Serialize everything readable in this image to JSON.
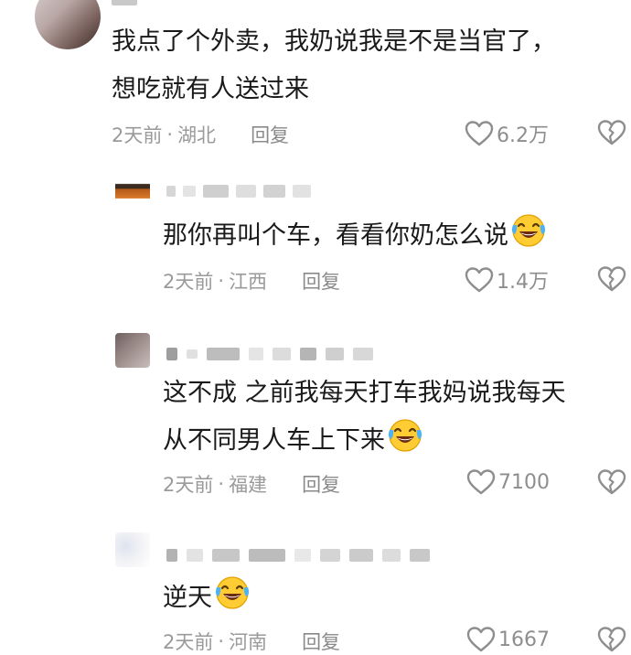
{
  "comments": [
    {
      "text_lines": [
        "我点了个外卖，我奶说我是不是当官了，",
        "想吃就有人送过来"
      ],
      "time": "2天前",
      "location": "湖北",
      "reply_label": "回复",
      "likes": "6.2万",
      "emoji": ""
    },
    {
      "text_lines": [
        "那你再叫个车，看看你奶怎么说"
      ],
      "time": "2天前",
      "location": "江西",
      "reply_label": "回复",
      "likes": "1.4万",
      "emoji": "laugh-cry"
    },
    {
      "text_lines": [
        "这不成 之前我每天打车我妈说我每天",
        "从不同男人车上下来"
      ],
      "time": "2天前",
      "location": "福建",
      "reply_label": "回复",
      "likes": "7100",
      "emoji": "laugh-cry"
    },
    {
      "text_lines": [
        "逆天"
      ],
      "time": "2天前",
      "location": "河南",
      "reply_label": "回复",
      "likes": "1667",
      "emoji": "laugh-cry"
    }
  ],
  "separator": "·",
  "icons": {
    "like": "heart-outline-icon",
    "dislike": "broken-heart-icon",
    "emoji": "laughing-crying-emoji-icon"
  },
  "colors": {
    "text": "#1a1a1a",
    "meta": "#9a9a9a",
    "icon": "#8e8e8e"
  }
}
